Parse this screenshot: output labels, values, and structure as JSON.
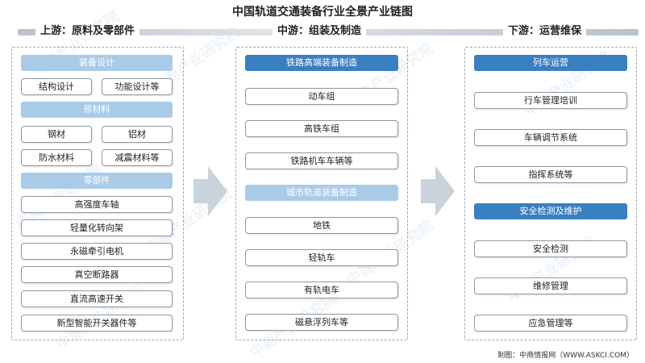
{
  "title": "中国轨道交通装备行业全景产业链图",
  "upstream": {
    "heading": "上游：原料及零部件",
    "sections": {
      "equipment_design": {
        "label": "装备设计",
        "items": [
          "结构设计",
          "功能设计等"
        ]
      },
      "raw_materials": {
        "label": "原材料",
        "items": [
          "钢材",
          "铝材",
          "防水材料",
          "减震材料等"
        ]
      },
      "components": {
        "label": "零部件",
        "items": [
          "高强度车轴",
          "轻量化转向架",
          "永磁牵引电机",
          "真空断路器",
          "直流高速开关",
          "新型智能开关器件等"
        ]
      }
    }
  },
  "midstream": {
    "heading": "中游：组装及制造",
    "sections": {
      "railway": {
        "label": "铁路高端装备制造",
        "items": [
          "动车组",
          "高铁车组",
          "铁路机车车辆等"
        ]
      },
      "urban": {
        "label": "城市轨道装备制造",
        "items": [
          "地铁",
          "轻轨车",
          "有轨电车",
          "磁悬浮列车等"
        ]
      }
    }
  },
  "downstream": {
    "heading": "下游：运营维保",
    "sections": {
      "operation": {
        "label": "列车运营",
        "items": [
          "行车管理培训",
          "车辆调节系统",
          "指挥系统等"
        ]
      },
      "maintenance": {
        "label": "安全检测及维护",
        "items": [
          "安全检测",
          "维修管理",
          "应急管理等"
        ]
      }
    }
  },
  "footer": "制图：中商情报网（WWW.ASKCI.COM）",
  "watermark": "中商产业研究院",
  "colors": {
    "light_header": "#a9cbe8",
    "dark_header": "#3a7fc0",
    "arrow": "#c9d3de"
  }
}
